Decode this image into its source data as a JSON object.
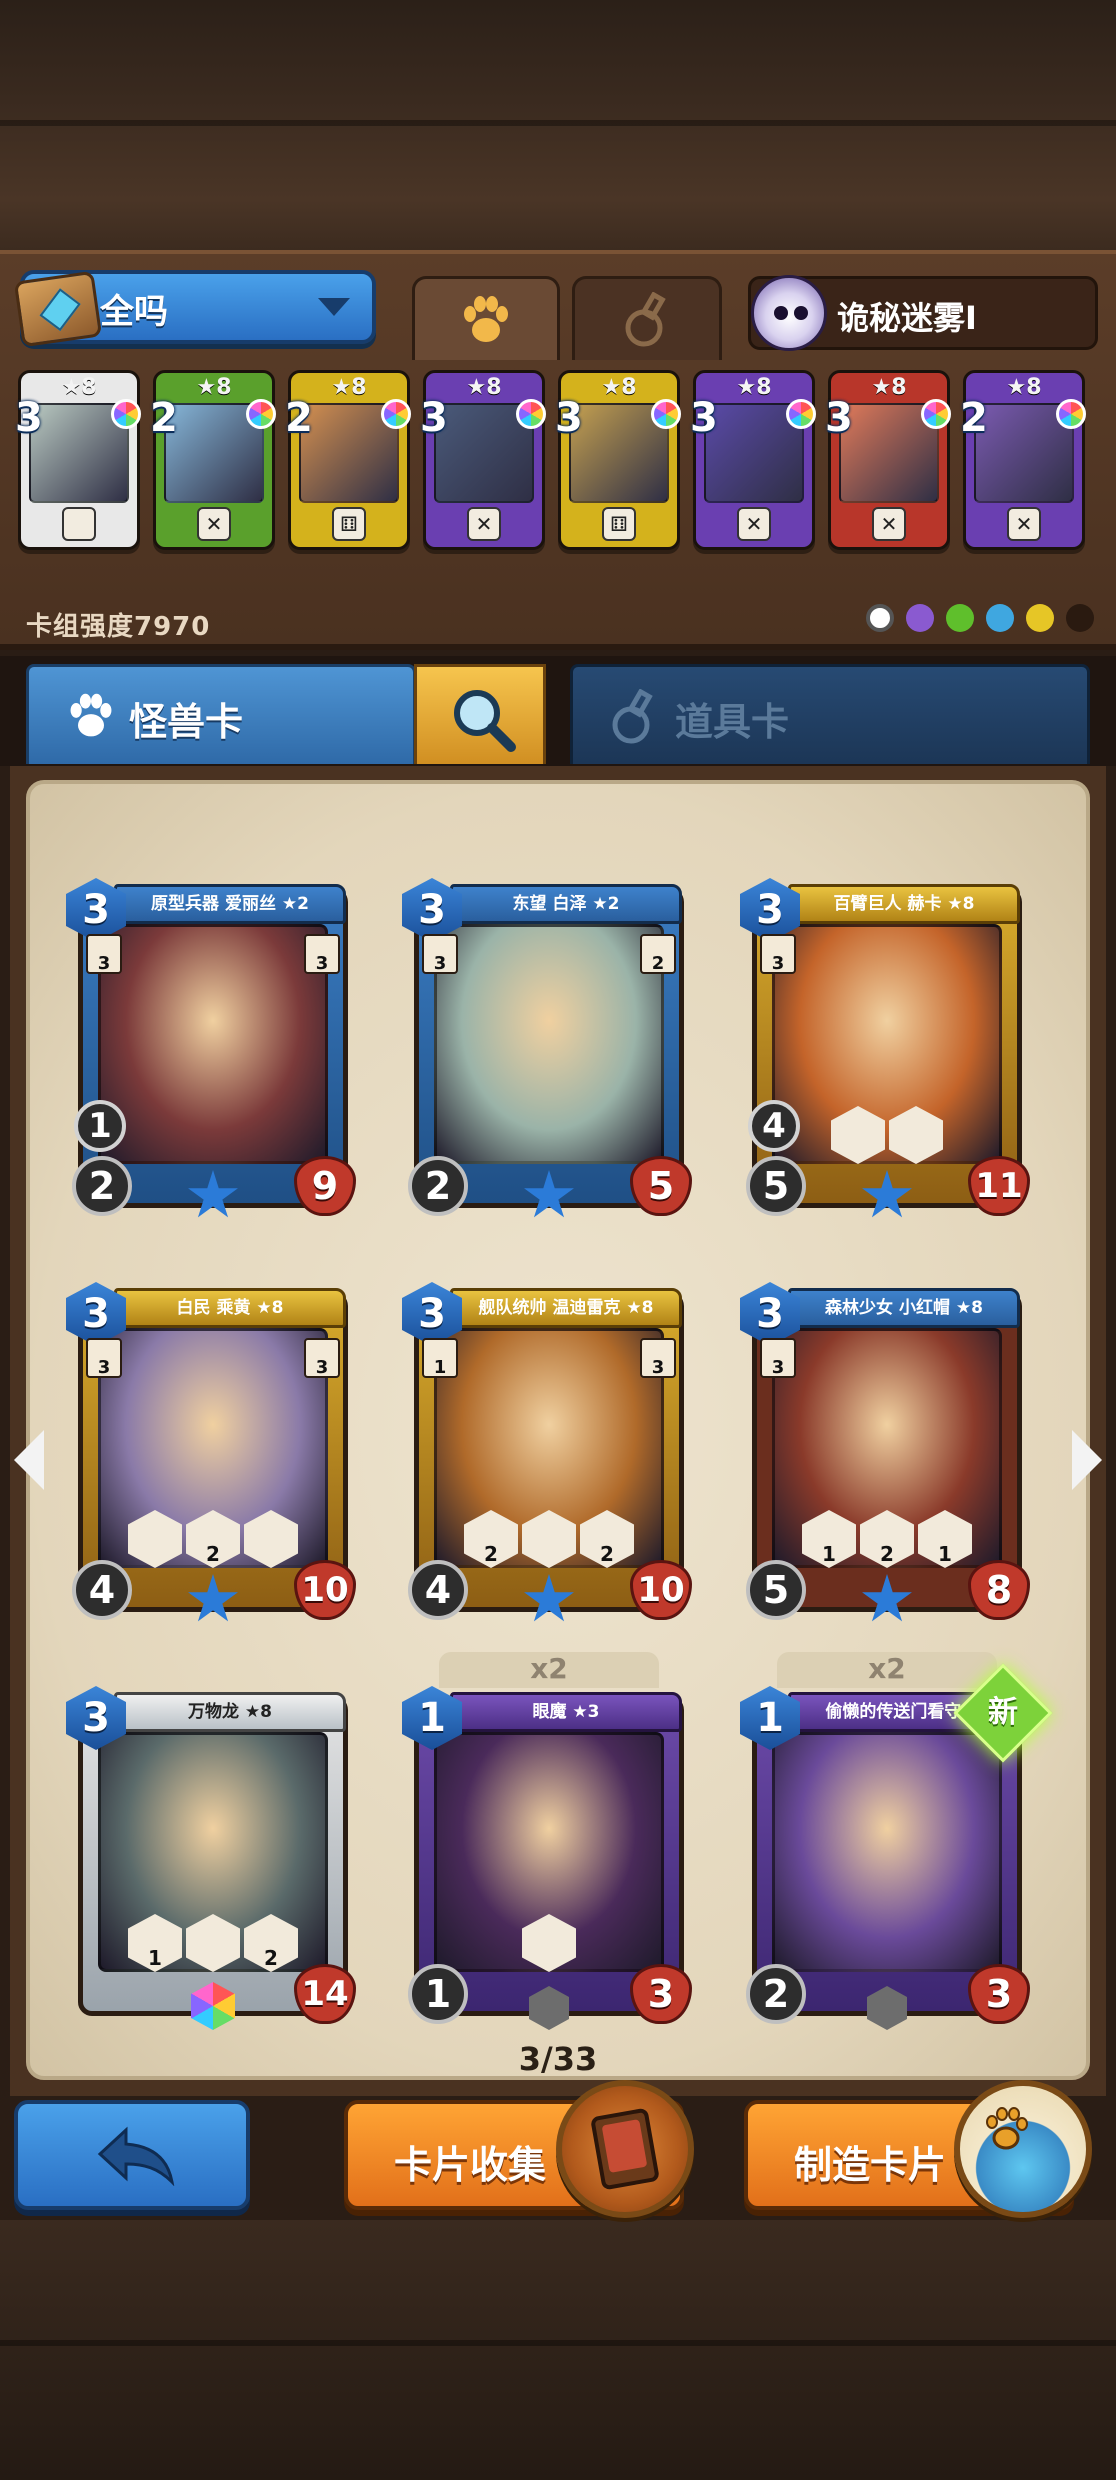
{
  "deck": {
    "name": "全吗",
    "tabs": [
      "monster-tab-icon",
      "item-tab-icon"
    ],
    "opponent_label": "诡秘迷雾I",
    "power_label": "卡组强度7970",
    "cards": [
      {
        "cost": "3",
        "stars": "★8",
        "frame": "#e8e8e8",
        "bottom": "",
        "art": "#b9c9c1"
      },
      {
        "cost": "2",
        "stars": "★8",
        "frame": "#5aa02c",
        "bottom": "✕",
        "art": "#86b6d8"
      },
      {
        "cost": "2",
        "stars": "★8",
        "frame": "#d4b21c",
        "bottom": "⚅",
        "art": "#d49050"
      },
      {
        "cost": "3",
        "stars": "★8",
        "frame": "#6a3fb1",
        "bottom": "✕",
        "art": "#4a5a7a"
      },
      {
        "cost": "3",
        "stars": "★8",
        "frame": "#d4b21c",
        "bottom": "⚅",
        "art": "#c4a050"
      },
      {
        "cost": "3",
        "stars": "★8",
        "frame": "#6a3fb1",
        "bottom": "✕",
        "art": "#5a4aa8"
      },
      {
        "cost": "3",
        "stars": "★8",
        "frame": "#b8362a",
        "bottom": "✕",
        "art": "#e07a5a"
      },
      {
        "cost": "2",
        "stars": "★8",
        "frame": "#6a3fb1",
        "bottom": "✕",
        "art": "#7a5ab0"
      }
    ]
  },
  "type_tabs": {
    "monster_label": "怪兽卡",
    "item_label": "道具卡"
  },
  "cards": [
    {
      "name": "原型兵器 爱丽丝 ★2",
      "cost": "3",
      "atk": "2",
      "hp": "9",
      "spd": "1",
      "left": "3",
      "right": "3",
      "frame": "blue",
      "art": "#7b3a3a",
      "skills": [],
      "tier": "star"
    },
    {
      "name": "东望 白泽 ★2",
      "cost": "3",
      "atk": "2",
      "hp": "5",
      "spd": "",
      "left": "3",
      "right": "2",
      "frame": "blue",
      "art": "#9ab3a8",
      "skills": [],
      "tier": "star"
    },
    {
      "name": "百臂巨人 赫卡 ★8",
      "cost": "3",
      "atk": "5",
      "hp": "11",
      "spd": "4",
      "left": "3",
      "right": "",
      "frame": "gold",
      "art": "#c4642a",
      "skills": [
        "",
        ""
      ],
      "tier": "star"
    },
    {
      "name": "白民 乘黄 ★8",
      "cost": "3",
      "atk": "4",
      "hp": "10",
      "spd": "",
      "left": "3",
      "right": "3",
      "frame": "gold",
      "art": "#8a7aa8",
      "skills": [
        "",
        "2",
        ""
      ],
      "tier": "star"
    },
    {
      "name": "舰队统帅 温迪雷克 ★8",
      "cost": "3",
      "atk": "4",
      "hp": "10",
      "spd": "",
      "left": "1",
      "right": "3",
      "frame": "gold",
      "art": "#b06a2a",
      "skills": [
        "2",
        "",
        "2"
      ],
      "tier": "star"
    },
    {
      "name": "森林少女 小红帽 ★8",
      "cost": "3",
      "atk": "5",
      "hp": "8",
      "spd": "",
      "left": "3",
      "right": "",
      "frame": "red",
      "art": "#8a3a2a",
      "skills": [
        "1",
        "2",
        "1"
      ],
      "tier": "star"
    },
    {
      "name": "万物龙 ★8",
      "cost": "3",
      "atk": "",
      "hp": "14",
      "spd": "",
      "left": "",
      "right": "",
      "frame": "silver",
      "art": "#5a6a6a",
      "skills": [
        "1",
        "",
        "2"
      ],
      "tier": "rainbow",
      "badge": "1"
    },
    {
      "name": "眼魔 ★3",
      "cost": "1",
      "atk": "1",
      "hp": "3",
      "spd": "",
      "left": "",
      "right": "",
      "frame": "purple",
      "art": "#4a2a5a",
      "skills": [
        ""
      ],
      "tier": "hex",
      "copies": "x2"
    },
    {
      "name": "偷懒的传送门看守 ★",
      "cost": "1",
      "atk": "2",
      "hp": "3",
      "spd": "",
      "left": "",
      "right": "",
      "frame": "purple",
      "art": "#6a4a9a",
      "skills": [],
      "tier": "hex",
      "copies": "x2",
      "new": "新"
    }
  ],
  "pagination": {
    "label": "3/33"
  },
  "buttons": {
    "back": "back-arrow-icon",
    "collect_label": "卡片收集",
    "craft_label": "制造卡片"
  },
  "colors": {
    "accent_blue": "#2a6fc3",
    "accent_orange": "#e2701a",
    "parchment": "#e8dcc2",
    "wood": "#4a3221"
  }
}
